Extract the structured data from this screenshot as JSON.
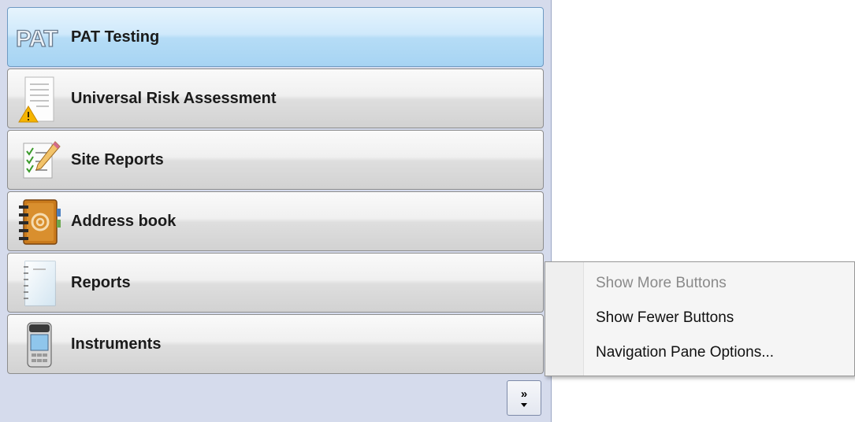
{
  "nav_pane": {
    "buttons": [
      {
        "label": "PAT Testing",
        "icon": "pat-logo-icon",
        "selected": true
      },
      {
        "label": "Universal Risk Assessment",
        "icon": "warning-document-icon",
        "selected": false
      },
      {
        "label": "Site Reports",
        "icon": "checklist-pencil-icon",
        "selected": false
      },
      {
        "label": "Address book",
        "icon": "address-book-icon",
        "selected": false
      },
      {
        "label": "Reports",
        "icon": "notepad-icon",
        "selected": false
      },
      {
        "label": "Instruments",
        "icon": "tester-device-icon",
        "selected": false
      }
    ],
    "pat_logo_text": "PAT",
    "chevron_glyph": "»"
  },
  "context_menu": {
    "items": [
      {
        "label": "Show More Buttons",
        "enabled": false
      },
      {
        "label": "Show Fewer Buttons",
        "enabled": true
      },
      {
        "label": "Navigation Pane Options...",
        "enabled": true
      }
    ]
  },
  "colors": {
    "selected_button": "#b5dcf6",
    "pane_background": "#d5dbec",
    "warning_yellow": "#f5b400"
  }
}
